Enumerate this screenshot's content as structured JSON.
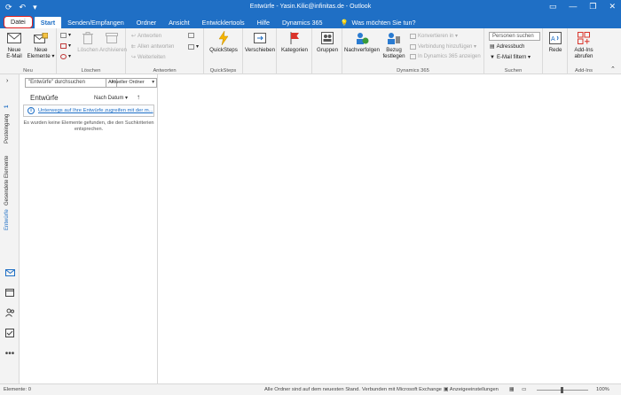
{
  "titlebar": {
    "title": "Entwürfe - Yasin.Kilic@infinitas.de - Outlook",
    "sync_icon": "sync-icon",
    "undo_icon": "undo-icon",
    "min": "—",
    "restore": "❐",
    "close": "✕",
    "ribbon_display": "▭"
  },
  "tabs": {
    "file": "Datei",
    "start": "Start",
    "send_receive": "Senden/Empfangen",
    "folder": "Ordner",
    "view": "Ansicht",
    "developer": "Entwicklertools",
    "help": "Hilfe",
    "dynamics": "Dynamics 365",
    "tell_me": "Was möchten Sie tun?"
  },
  "ribbon": {
    "new": {
      "label": "Neu",
      "new_email": "Neue\nE-Mail",
      "new_items": "Neue\nElemente ▾"
    },
    "delete": {
      "label": "Löschen",
      "delete": "Löschen",
      "archive": "Archivieren"
    },
    "respond": {
      "label": "Antworten",
      "reply": "Antworten",
      "reply_all": "Allen antworten",
      "forward": "Weiterleiten"
    },
    "quicksteps": {
      "label": "QuickSteps",
      "button": "QuickSteps"
    },
    "move": {
      "button": "Verschieben"
    },
    "tags": {
      "button": "Kategorien"
    },
    "groups": {
      "button": "Gruppen"
    },
    "dynamics": {
      "label": "Dynamics 365",
      "track": "Nachverfolgen",
      "set_regarding": "Bezug\nfestlegen",
      "convert": "Konvertieren in ▾",
      "add_connection": "Verbindung hinzufügen ▾",
      "view_in": "In Dynamics 365 anzeigen"
    },
    "find": {
      "label": "Suchen",
      "people_placeholder": "Personen suchen",
      "address_book": "Adressbuch",
      "filter_email": "E-Mail filtern ▾"
    },
    "speech": {
      "button": "Rede"
    },
    "addins": {
      "label": "Add-Ins",
      "button": "Add-Ins\nabrufen"
    }
  },
  "leftnav": {
    "inbox": "Posteingang",
    "inbox_count": "1",
    "sent": "Gesendete Elemente",
    "drafts": "Entwürfe"
  },
  "list": {
    "search_placeholder": "\"Entwürfe\" durchsuchen",
    "scope": "Aktueller Ordner",
    "heading": "Entwürfe",
    "sort": "Nach Datum ▾",
    "info": "Unterwegs auf Ihre Entwürfe zugreifen mit der m...",
    "empty": "Es wurden keine Elemente gefunden, die den Suchkriterien entsprechen."
  },
  "statusbar": {
    "items": "Elemente: 0",
    "status": "Alle Ordner sind auf dem neuesten Stand.",
    "connection": "Verbunden mit Microsoft Exchange",
    "display_settings": "Anzeigeeinstellungen",
    "zoom": "100%"
  },
  "colors": {
    "accent": "#1f6fc5",
    "file_outline": "#e02020",
    "ribbon_bg": "#f3f3f3"
  }
}
